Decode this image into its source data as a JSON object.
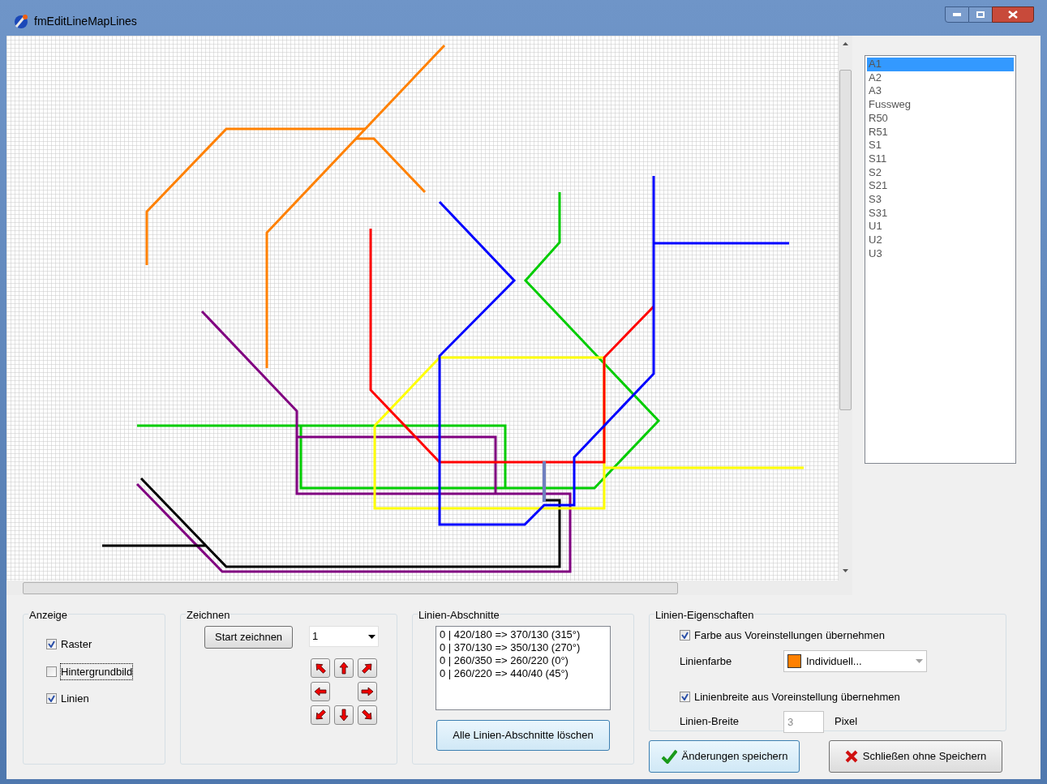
{
  "window": {
    "title": "fmEditLineMapLines"
  },
  "line_list": {
    "items": [
      {
        "label": "A1",
        "selected": true
      },
      {
        "label": "A2",
        "selected": false
      },
      {
        "label": "A3",
        "selected": false
      },
      {
        "label": "Fussweg",
        "selected": false
      },
      {
        "label": "R50",
        "selected": false
      },
      {
        "label": "R51",
        "selected": false
      },
      {
        "label": "S1",
        "selected": false
      },
      {
        "label": "S11",
        "selected": false
      },
      {
        "label": "S2",
        "selected": false
      },
      {
        "label": "S21",
        "selected": false
      },
      {
        "label": "S3",
        "selected": false
      },
      {
        "label": "S31",
        "selected": false
      },
      {
        "label": "U1",
        "selected": false
      },
      {
        "label": "U2",
        "selected": false
      },
      {
        "label": "U3",
        "selected": false
      }
    ]
  },
  "anzeige": {
    "title": "Anzeige",
    "checkboxes": [
      {
        "label": "Raster",
        "checked": true,
        "focused": false
      },
      {
        "label": "Hintergrundbild",
        "checked": false,
        "focused": true
      },
      {
        "label": "Linien",
        "checked": true,
        "focused": false
      }
    ]
  },
  "zeichnen": {
    "title": "Zeichnen",
    "start_button": "Start zeichnen",
    "step_dropdown": {
      "value": "1"
    }
  },
  "linien_abschnitte": {
    "title": "Linien-Abschnitte",
    "segments": [
      "0 | 420/180 => 370/130 (315°)",
      "0 | 370/130 => 350/130 (270°)",
      "0 | 260/350 => 260/220 (0°)",
      "0 | 260/220 => 440/40 (45°)"
    ],
    "delete_button": "Alle Linien-Abschnitte löschen"
  },
  "linien_eigenschaften": {
    "title": "Linien-Eigenschaften",
    "color_default": {
      "label": "Farbe aus Voreinstellungen übernehmen",
      "checked": true
    },
    "color_label": "Linienfarbe",
    "color_dropdown": {
      "value": "Individuell...",
      "color": "#ff8000"
    },
    "width_default": {
      "label": "Linienbreite aus Voreinstellung übernehmen",
      "checked": true
    },
    "width_label": "Linien-Breite",
    "width_field": {
      "value": "3",
      "disabled": true
    },
    "width_unit": "Pixel"
  },
  "buttons": {
    "save": "Änderungen speichern",
    "close": "Schließen ohne Speichern"
  }
}
